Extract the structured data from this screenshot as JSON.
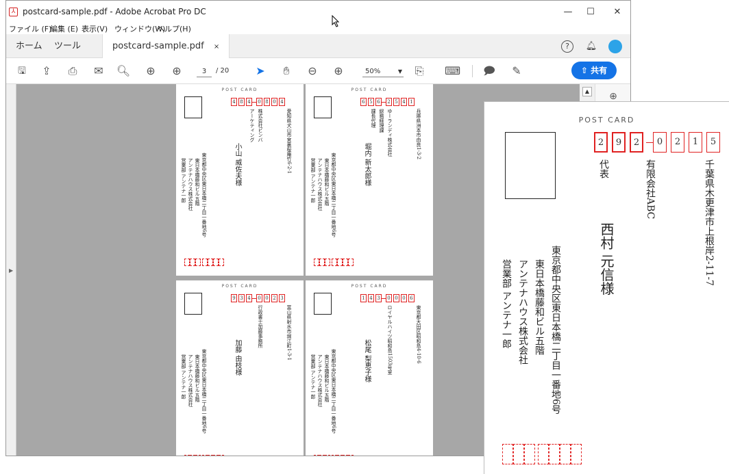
{
  "window": {
    "title": "postcard-sample.pdf - Adobe Acrobat Pro DC",
    "controls": {
      "minimize": "—",
      "maximize": "☐",
      "close": "✕"
    }
  },
  "menu": [
    "ファイル (F)",
    "編集 (E)",
    "表示(V)",
    "ウィンドウ(W)",
    "ヘルプ(H)"
  ],
  "tabs": {
    "home": "ホーム",
    "tools": "ツール",
    "document": "postcard-sample.pdf",
    "close": "×"
  },
  "toolbar": {
    "page_current": "3",
    "page_total": "/ 20",
    "zoom": "50%",
    "share_label": "共有"
  },
  "icons": {
    "save": "save-icon",
    "upload": "cloud-upload-icon",
    "print": "print-icon",
    "mail": "mail-icon",
    "search": "search-icon",
    "prev": "prev-page-icon",
    "next": "next-page-icon",
    "select": "arrow-tool-icon",
    "hand": "hand-tool-icon",
    "zoom_out": "zoom-out-icon",
    "zoom_in": "zoom-in-icon"
  },
  "postcards": [
    {
      "header": "POST CARD",
      "zip": [
        "4",
        "8",
        "4",
        "0",
        "8",
        "0",
        "4"
      ],
      "address": "愛知県犬山市宮裏桜庵竹6-2-1",
      "company": "株式会社ビンバ",
      "title": "アーケティング",
      "name": "小山 威佐夫様",
      "sender": [
        "東京都中央区東日本橋二丁目一番地6号",
        "東日本橋藤和ビル五階",
        "アンテナハウス株式会社",
        "営業部 アンテナ一郎"
      ]
    },
    {
      "header": "POST CARD",
      "zip": [
        "6",
        "5",
        "6",
        "2",
        "5",
        "4",
        "1"
      ],
      "address": "兵庫県洲本市由良1-3-2",
      "company": "ゆーランディ株式会社",
      "title": "総務経理課",
      "title2": "課長代理",
      "name": "堀内 新太郎様",
      "sender": [
        "東京都中央区東日本橋二丁目一番地6号",
        "東日本橋藤和ビル五階",
        "アンテナハウス株式会社",
        "営業部 アンテナ一郎"
      ]
    },
    {
      "header": "POST CARD",
      "zip": [
        "9",
        "3",
        "4",
        "0",
        "0",
        "2",
        "3"
      ],
      "address": "富山県射水市堀江町1-3-1",
      "company": "行政書士加藤事務所",
      "title": "",
      "name": "加藤 由枝様",
      "sender": [
        "東京都中央区東日本橋二丁目一番地6号",
        "東日本橋藤和ビル五階",
        "アンテナハウス株式会社",
        "営業部 アンテナ一郎"
      ]
    },
    {
      "header": "POST CARD",
      "zip": [
        "1",
        "4",
        "3",
        "0",
        "0",
        "0",
        "6"
      ],
      "address": "東京都大田区昭和島4-10-6",
      "company": "ロイヤルハイツ昭和島1503号室",
      "title": "",
      "name": "松尾 梨恵子様",
      "sender": [
        "東京都中央区東日本橋二丁目一番地6号",
        "東日本橋藤和ビル五階",
        "アンテナハウス株式会社",
        "営業部 アンテナ一郎"
      ]
    }
  ],
  "zoomed_card": {
    "header": "POST CARD",
    "zip": [
      "2",
      "9",
      "2",
      "0",
      "2",
      "1",
      "5"
    ],
    "address": "千葉県木更津市上根岸2-11-7",
    "company": "有限会社ABC",
    "title": "代表",
    "name": "西村 元信様",
    "sender": [
      "東京都中央区東日本橋二丁目一番地6号",
      "東日本橋藤和ビル五階",
      "アンテナハウス株式会社",
      "営業部 アンテナ一郎"
    ]
  },
  "colors": {
    "accent": "#1473e6",
    "zip_red": "#e02020",
    "canvas": "#a7a7a7"
  }
}
